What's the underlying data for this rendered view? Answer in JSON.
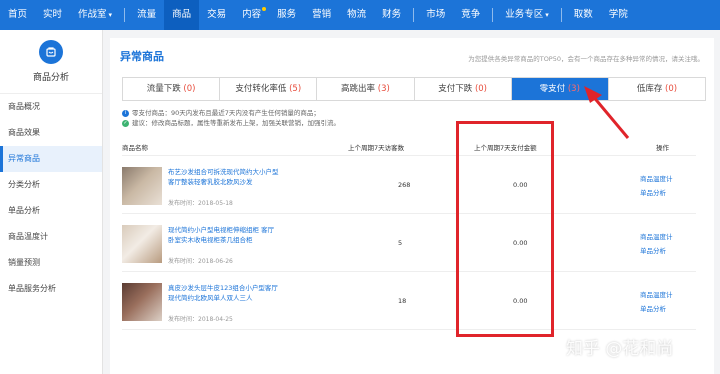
{
  "topnav": {
    "items": [
      {
        "label": "首页"
      },
      {
        "label": "实时"
      },
      {
        "label": "作战室",
        "chevron": true
      },
      {
        "label": "流量"
      },
      {
        "label": "商品",
        "active": true
      },
      {
        "label": "交易"
      },
      {
        "label": "内容",
        "dot": true
      },
      {
        "label": "服务"
      },
      {
        "label": "营销"
      },
      {
        "label": "物流"
      },
      {
        "label": "财务"
      },
      {
        "label": "市场"
      },
      {
        "label": "竞争"
      },
      {
        "label": "业务专区",
        "chevron": true
      },
      {
        "label": "取数"
      },
      {
        "label": "学院"
      }
    ]
  },
  "sidebar": {
    "title": "商品分析",
    "items": [
      {
        "label": "商品概况"
      },
      {
        "label": "商品效果"
      },
      {
        "label": "异常商品",
        "active": true
      },
      {
        "label": "分类分析"
      },
      {
        "label": "单品分析"
      },
      {
        "label": "商品温度计"
      },
      {
        "label": "销量预测"
      },
      {
        "label": "单品服务分析"
      }
    ]
  },
  "main": {
    "title": "异常商品",
    "description": "为您提供各类异常商品的TOP50，会有一个商品存在多种异常的情况，请关注哦。",
    "tabs": [
      {
        "label": "流量下跌",
        "count": "(0)"
      },
      {
        "label": "支付转化率低",
        "count": "(5)"
      },
      {
        "label": "高跳出率",
        "count": "(3)"
      },
      {
        "label": "支付下跌",
        "count": "(0)"
      },
      {
        "label": "零支付",
        "count": "(3)",
        "active": true
      },
      {
        "label": "低库存",
        "count": "(0)"
      }
    ],
    "tips": [
      "零支付商品：90天内发布且最近7天内没有产生任何销量的商品；",
      "建议：修改商品标题，属性等重新发布上架，加强关联营销，加强引流。"
    ],
    "table": {
      "headers": [
        "商品名称",
        "上个周期7天访客数",
        "上个周期7天支付金额",
        "操作"
      ],
      "rows": [
        {
          "name": "布艺沙发组合可拆洗现代简约大小户型客厅整装轻奢乳胶北欧风沙发",
          "date": "发布时间：2018-05-18",
          "visits": "268",
          "amount": "0.00",
          "actions": [
            "商品温度计",
            "单品分析"
          ]
        },
        {
          "name": "现代简约小户型电视柜伸缩组柜 客厅卧室实木收电视柜茶几组合柜",
          "date": "发布时间：2018-06-26",
          "visits": "5",
          "amount": "0.00",
          "actions": [
            "商品温度计",
            "单品分析"
          ]
        },
        {
          "name": "真皮沙发头层牛皮123组合小户型客厅现代简约北欧风单人双人三人",
          "date": "发布时间：2018-04-25",
          "visits": "18",
          "amount": "0.00",
          "actions": [
            "商品温度计",
            "单品分析"
          ]
        }
      ]
    }
  },
  "watermark": "知乎 @花和尚",
  "colors": {
    "brand": "#1c74d8",
    "highlight": "#e0242a",
    "count": "#e74c3c"
  }
}
